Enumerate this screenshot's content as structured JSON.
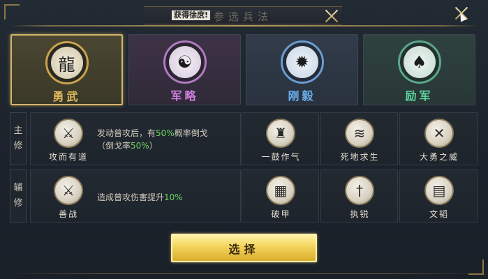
{
  "header": {
    "title": "参选兵法",
    "tag": "获得徐庶!"
  },
  "categories": [
    {
      "label": "勇武",
      "icon": "dragon-icon",
      "color": "#d9b25a",
      "selected": true
    },
    {
      "label": "军略",
      "icon": "taiji-icon",
      "color": "#c978d8",
      "selected": false
    },
    {
      "label": "刚毅",
      "icon": "spiked-ball-icon",
      "color": "#66aef0",
      "selected": false
    },
    {
      "label": "励军",
      "icon": "pouch-icon",
      "color": "#59cf9a",
      "selected": false
    }
  ],
  "main_row": {
    "tag": [
      "主",
      "修"
    ],
    "skill": {
      "name": "攻而有道",
      "icon": "axe-icon",
      "glyph": "⚔"
    },
    "desc_line1_a": "发动普攻后，有",
    "desc_line1_b": "50%",
    "desc_line1_c": "概率倒戈",
    "desc_line2_a": "（倒戈率",
    "desc_line2_b": "50%",
    "desc_line2_c": "）",
    "options": [
      {
        "name": "一鼓作气",
        "icon": "warrior-icon",
        "glyph": "♜"
      },
      {
        "name": "死地求生",
        "icon": "wing-icon",
        "glyph": "≋"
      },
      {
        "name": "大勇之威",
        "icon": "crossed-blades-icon",
        "glyph": "✕"
      }
    ]
  },
  "sub_row": {
    "tag": [
      "辅",
      "修"
    ],
    "skill": {
      "name": "善战",
      "icon": "crossed-swords-icon",
      "glyph": "⚔"
    },
    "desc_a": "造成普攻伤害提升",
    "desc_b": "10%",
    "options": [
      {
        "name": "破甲",
        "icon": "armor-icon",
        "glyph": "▦"
      },
      {
        "name": "执锐",
        "icon": "blade-icon",
        "glyph": "†"
      },
      {
        "name": "文韬",
        "icon": "scroll-icon",
        "glyph": "▤"
      }
    ]
  },
  "select_button": {
    "label": "选择"
  }
}
